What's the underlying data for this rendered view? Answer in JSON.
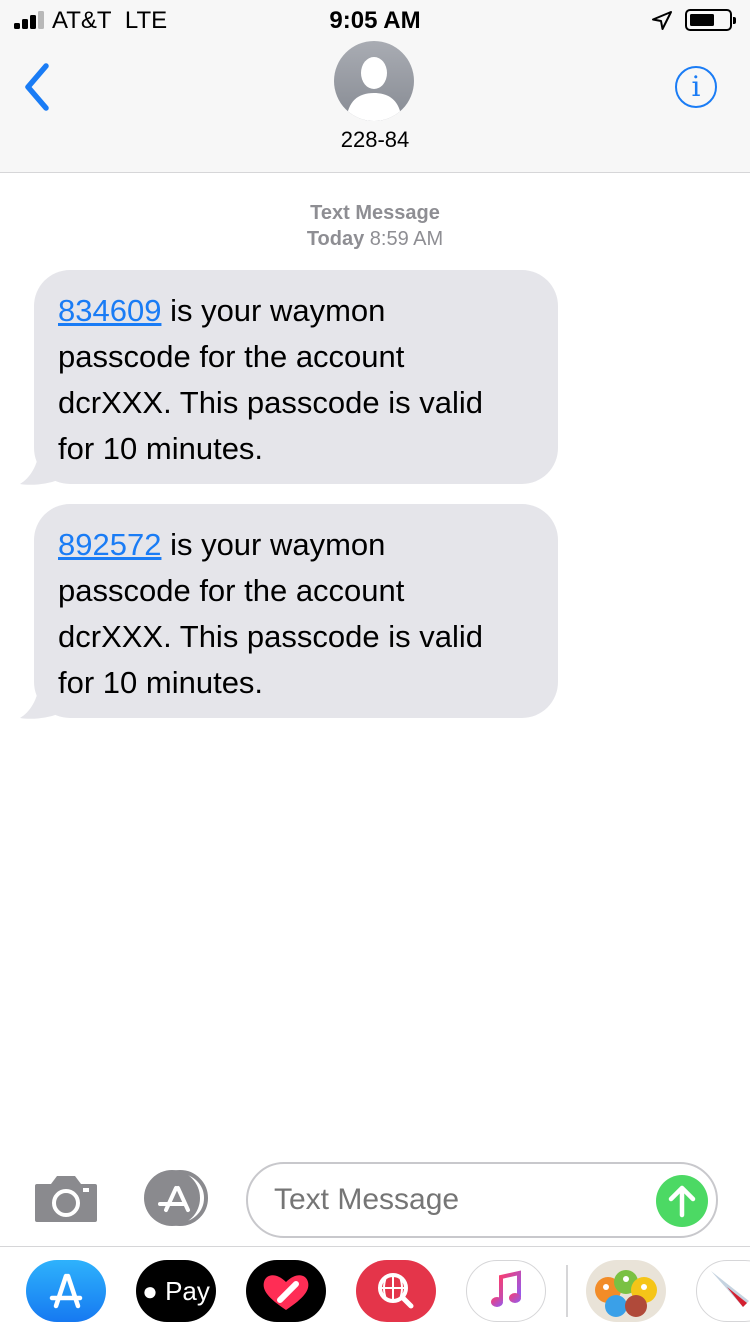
{
  "status_bar": {
    "carrier": "AT&T",
    "network": "LTE",
    "time": "9:05 AM"
  },
  "header": {
    "contact_name": "228-84",
    "info_label": "i"
  },
  "conversation": {
    "type_label": "Text Message",
    "day_label": "Today",
    "time_label": "8:59 AM",
    "messages": [
      {
        "code": "834609",
        "line1_rest": " is your waymon",
        "line2": "passcode for the account",
        "line3": "dcrXXX. This passcode is valid",
        "line4": "for 10 minutes."
      },
      {
        "code": "892572",
        "line1_rest": " is your waymon",
        "line2": "passcode for the account",
        "line3": "dcrXXX. This passcode is valid",
        "line4": "for 10 minutes."
      }
    ]
  },
  "input": {
    "placeholder": "Text Message"
  },
  "drawer": {
    "apple_pay_label": " Pay",
    "apps": [
      "app-store",
      "apple-pay",
      "digital-touch",
      "images-search",
      "music",
      "stickers",
      "airline"
    ]
  },
  "colors": {
    "accent": "#1a7cf5",
    "bubble": "#e5e5ea",
    "send": "#4cd964"
  }
}
